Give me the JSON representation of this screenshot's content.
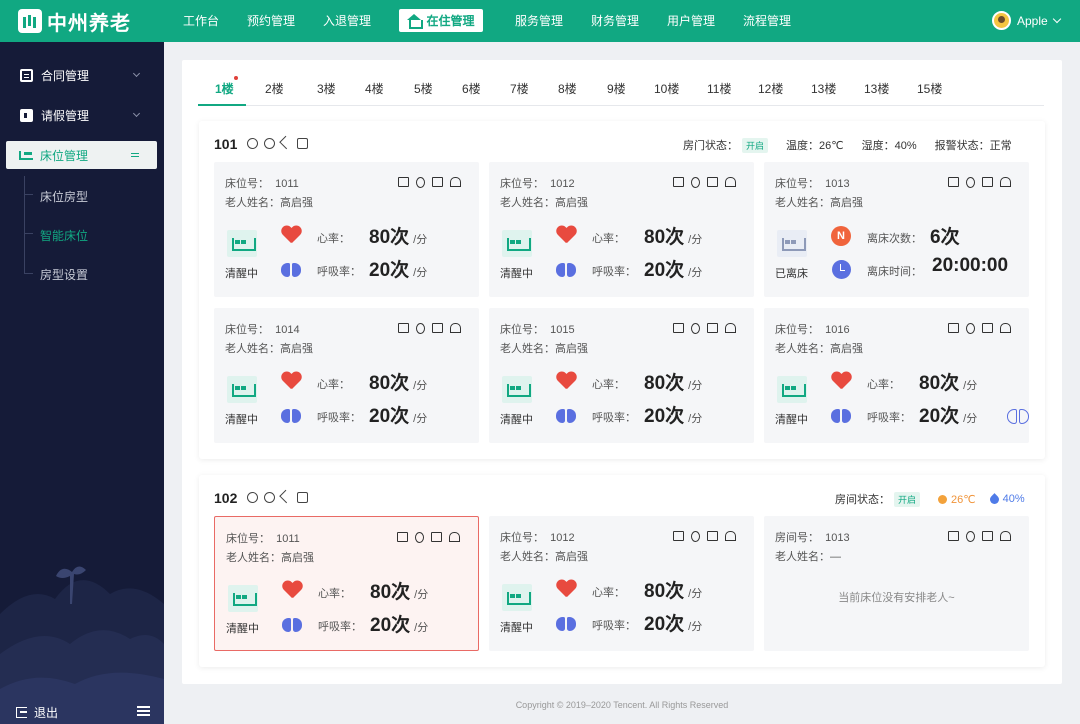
{
  "app": {
    "title": "中州养老"
  },
  "nav": {
    "items": [
      "工作台",
      "预约管理",
      "入退管理",
      "服务管理",
      "财务管理",
      "用户管理",
      "流程管理"
    ],
    "active": "在住管理"
  },
  "user": {
    "name": "Apple"
  },
  "sidebar": {
    "items": [
      {
        "label": "合同管理"
      },
      {
        "label": "请假管理"
      }
    ],
    "active": "床位管理",
    "sub": [
      "床位房型",
      "智能床位",
      "房型设置"
    ],
    "logout": "退出"
  },
  "floors": [
    "1楼",
    "2楼",
    "3楼",
    "4楼",
    "5楼",
    "6楼",
    "7楼",
    "8楼",
    "9楼",
    "10楼",
    "11楼",
    "12楼",
    "13楼",
    "13楼",
    "15楼"
  ],
  "room101": {
    "no": "101",
    "door_label": "房门状态：",
    "door_state": "开启",
    "temp": "温度：26℃",
    "humidity": "湿度：40%",
    "alarm": "报警状态：正常",
    "beds": [
      {
        "label": "床位号：",
        "no": "1011",
        "name_label": "老人姓名：",
        "name": "高启强",
        "state": "清醒中",
        "hr_label": "心率：",
        "hr": "80次",
        "rr_label": "呼吸率：",
        "rr": "20次",
        "unit": "/分"
      },
      {
        "label": "床位号：",
        "no": "1012",
        "name_label": "老人姓名：",
        "name": "高启强",
        "state": "清醒中",
        "hr_label": "心率：",
        "hr": "80次",
        "rr_label": "呼吸率：",
        "rr": "20次",
        "unit": "/分"
      },
      {
        "label": "床位号：",
        "no": "1013",
        "name_label": "老人姓名：",
        "name": "高启强",
        "state": "已离床",
        "leave_count_label": "离床次数：",
        "leave_count": "6次",
        "leave_time_label": "离床时间：",
        "leave_time": "20:00:00"
      },
      {
        "label": "床位号：",
        "no": "1014",
        "name_label": "老人姓名：",
        "name": "高启强",
        "state": "清醒中",
        "hr_label": "心率：",
        "hr": "80次",
        "rr_label": "呼吸率：",
        "rr": "20次",
        "unit": "/分"
      },
      {
        "label": "床位号：",
        "no": "1015",
        "name_label": "老人姓名：",
        "name": "高启强",
        "state": "清醒中",
        "hr_label": "心率：",
        "hr": "80次",
        "rr_label": "呼吸率：",
        "rr": "20次",
        "unit": "/分"
      },
      {
        "label": "床位号：",
        "no": "1016",
        "name_label": "老人姓名：",
        "name": "高启强",
        "state": "清醒中",
        "hr_label": "心率：",
        "hr": "80次",
        "rr_label": "呼吸率：",
        "rr": "20次",
        "unit": "/分"
      }
    ]
  },
  "room102": {
    "no": "102",
    "door_label": "房间状态：",
    "door_state": "开启",
    "temp": "26℃",
    "humidity": "40%",
    "beds": [
      {
        "label": "床位号：",
        "no": "1011",
        "name_label": "老人姓名：",
        "name": "高启强",
        "state": "清醒中",
        "hr_label": "心率：",
        "hr": "80次",
        "rr_label": "呼吸率：",
        "rr": "20次",
        "unit": "/分"
      },
      {
        "label": "床位号：",
        "no": "1012",
        "name_label": "老人姓名：",
        "name": "高启强",
        "state": "清醒中",
        "hr_label": "心率：",
        "hr": "80次",
        "rr_label": "呼吸率：",
        "rr": "20次",
        "unit": "/分"
      },
      {
        "label": "房间号：",
        "no": "1013",
        "name_label": "老人姓名：",
        "name": "—",
        "empty": "当前床位没有安排老人~"
      }
    ]
  },
  "footer": "Copyright © 2019–2020 Tencent. All Rights Reserved"
}
